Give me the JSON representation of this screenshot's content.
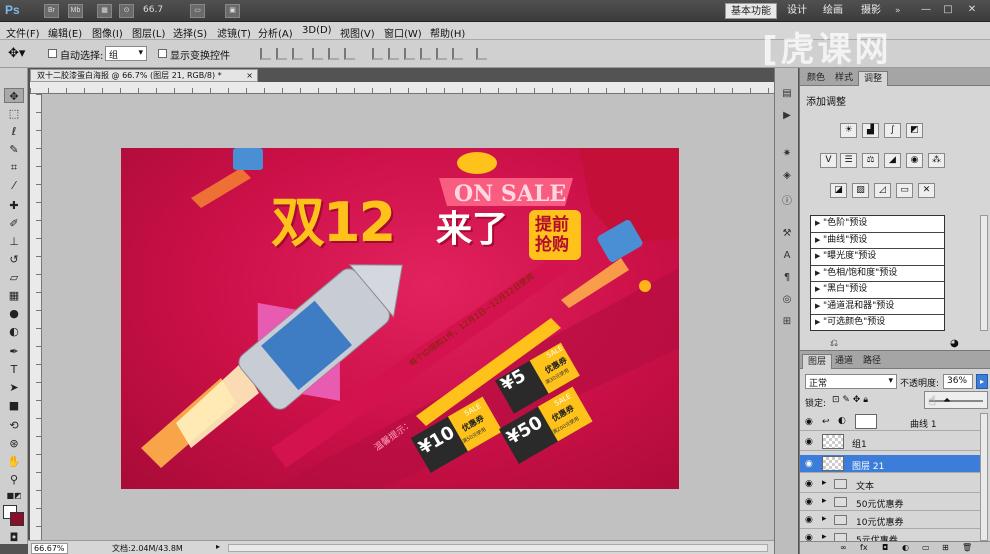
{
  "appbar": {
    "logo": "Ps",
    "icons": [
      "Br",
      "Mb"
    ],
    "zoom": "66.7",
    "workspaces": [
      "基本功能",
      "设计",
      "绘画",
      "摄影"
    ],
    "more": "»",
    "window_controls": [
      "—",
      "□",
      "✕"
    ]
  },
  "menu": [
    "文件(F)",
    "编辑(E)",
    "图像(I)",
    "图层(L)",
    "选择(S)",
    "滤镜(T)",
    "分析(A)",
    "3D(D)",
    "视图(V)",
    "窗口(W)",
    "帮助(H)"
  ],
  "options": {
    "auto_select_label": "自动选择:",
    "auto_select_value": "组",
    "show_transform_label": "显示变换控件"
  },
  "watermark": "[虎课网",
  "document": {
    "tab_title": "双十二胶漆蛋白海报 @ 66.7% (图层 21, RGB/8) *",
    "tab_close": "×",
    "zoom_status": "66.67%",
    "doc_status": "文档:2.04M/43.8M"
  },
  "poster": {
    "headline_a": "双12",
    "headline_b": "来了",
    "on_sale": "ON SALE",
    "badge": "提前抢购",
    "ribbon": "每个ID限购1件，12月1日~12月12日使用",
    "side_text": "温馨提示：",
    "coupons": [
      {
        "amount": "¥5",
        "sale": "SALE",
        "label": "优惠券",
        "cond": "满30元使用"
      },
      {
        "amount": "¥10",
        "sale": "SALE",
        "label": "优惠券",
        "cond": "满50元使用"
      },
      {
        "amount": "¥50",
        "sale": "SALE",
        "label": "优惠券",
        "cond": "满200元使用"
      }
    ]
  },
  "adjust_panel": {
    "tabs": [
      "颜色",
      "样式",
      "调整"
    ],
    "title": "添加调整",
    "presets": [
      "\"色阶\"预设",
      "\"曲线\"预设",
      "\"曝光度\"预设",
      "\"色相/饱和度\"预设",
      "\"黑白\"预设",
      "\"通道混和器\"预设",
      "\"可选颜色\"预设"
    ]
  },
  "layers_panel": {
    "tabs": [
      "图层",
      "通道",
      "路径"
    ],
    "blend_mode": "正常",
    "opacity_label": "不透明度:",
    "opacity_value": "36%",
    "lock_label": "锁定:",
    "layers": [
      {
        "name": "曲线 1",
        "kind": "adjustment"
      },
      {
        "name": "组1",
        "kind": "pixel"
      },
      {
        "name": "图层 21",
        "kind": "pixel"
      },
      {
        "name": "文本",
        "kind": "group"
      },
      {
        "name": "50元优惠券",
        "kind": "group"
      },
      {
        "name": "10元优惠券",
        "kind": "group"
      },
      {
        "name": "5元优惠券",
        "kind": "group"
      }
    ]
  },
  "colors": {
    "poster_bg": "#cc1048",
    "headline_yellow": "#ffc21a",
    "selection_blue": "#3b7dd8"
  }
}
